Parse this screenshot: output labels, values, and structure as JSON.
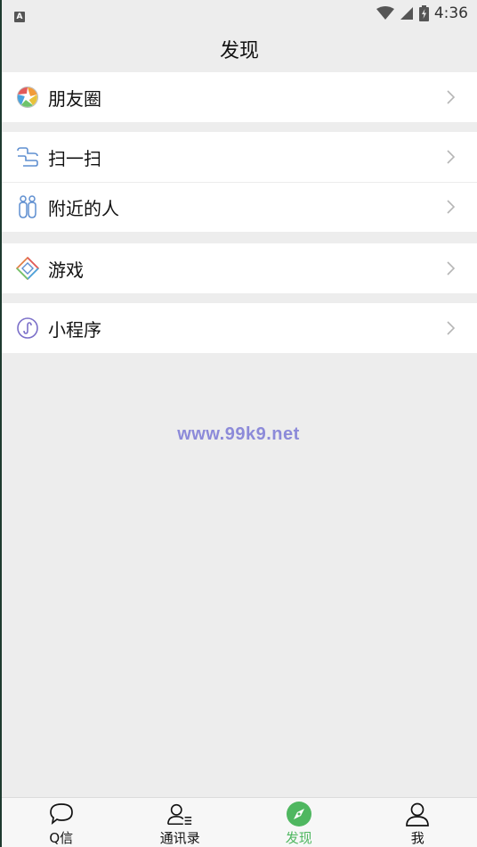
{
  "status_bar": {
    "left_badge": "A",
    "time": "4:36"
  },
  "header": {
    "title": "发现"
  },
  "menu": {
    "moments": {
      "label": "朋友圈",
      "icon": "moments-aperture-icon"
    },
    "scan": {
      "label": "扫一扫",
      "icon": "scan-icon"
    },
    "nearby": {
      "label": "附近的人",
      "icon": "nearby-people-icon"
    },
    "games": {
      "label": "游戏",
      "icon": "games-icon"
    },
    "mini_programs": {
      "label": "小程序",
      "icon": "mini-program-icon"
    }
  },
  "watermark": "www.99k9.net",
  "tabs": [
    {
      "label": "Q信",
      "icon": "chat-bubble-icon",
      "active": false
    },
    {
      "label": "通讯录",
      "icon": "contacts-icon",
      "active": false
    },
    {
      "label": "发现",
      "icon": "compass-icon",
      "active": true
    },
    {
      "label": "我",
      "icon": "person-icon",
      "active": false
    }
  ],
  "colors": {
    "background": "#ededed",
    "accent": "#4fb760",
    "watermark": "#8c8ad9"
  }
}
